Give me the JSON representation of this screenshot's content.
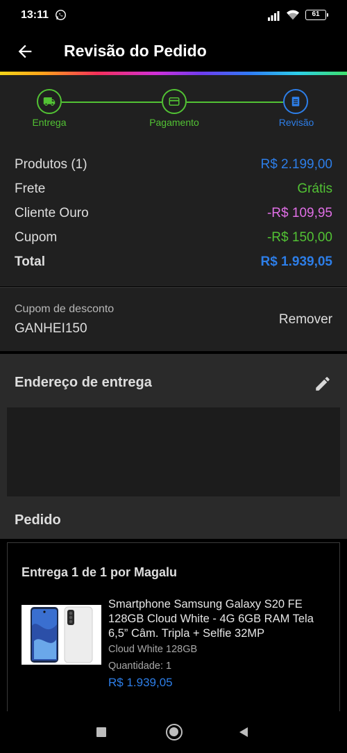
{
  "status_bar": {
    "time": "13:11",
    "battery": "61"
  },
  "header": {
    "title": "Revisão do Pedido"
  },
  "stepper": {
    "steps": [
      {
        "label": "Entrega"
      },
      {
        "label": "Pagamento"
      },
      {
        "label": "Revisão"
      }
    ]
  },
  "colors": {
    "green": "#52c234",
    "blue": "#2d7ee8",
    "pink": "#e06fe6"
  },
  "summary": {
    "rows": [
      {
        "label": "Produtos (1)",
        "value": "R$ 2.199,00"
      },
      {
        "label": "Frete",
        "value": "Grátis"
      },
      {
        "label": "Cliente Ouro",
        "value": "-R$ 109,95"
      },
      {
        "label": "Cupom",
        "value": "-R$ 150,00"
      },
      {
        "label": "Total",
        "value": "R$ 1.939,05"
      }
    ]
  },
  "coupon": {
    "label": "Cupom de desconto",
    "code": "GANHEI150",
    "remove": "Remover"
  },
  "address": {
    "title": "Endereço de entrega"
  },
  "order": {
    "title": "Pedido",
    "shipping": "Entrega 1 de 1 por Magalu",
    "product": {
      "name": "Smartphone Samsung Galaxy S20 FE 128GB Cloud White - 4G 6GB RAM Tela 6,5” Câm. Tripla + Selfie 32MP",
      "variant": "Cloud White 128GB",
      "quantity": "Quantidade:  1",
      "price": "R$ 1.939,05"
    }
  }
}
